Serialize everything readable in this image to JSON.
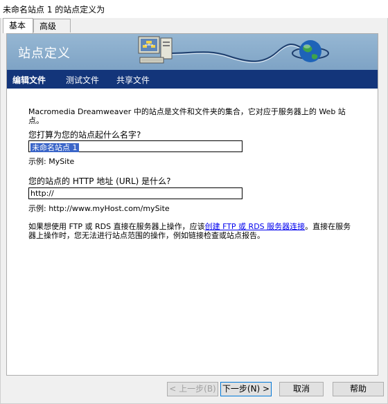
{
  "window": {
    "title": "未命名站点 1 的站点定义为"
  },
  "tabs": [
    {
      "label": "基本",
      "active": true
    },
    {
      "label": "高级",
      "active": false
    }
  ],
  "banner": {
    "title": "站点定义"
  },
  "subnav": [
    {
      "label": "编辑文件",
      "active": true
    },
    {
      "label": "测试文件",
      "active": false
    },
    {
      "label": "共享文件",
      "active": false
    }
  ],
  "form": {
    "description": "Macromedia Dreamweaver 中的站点是文件和文件夹的集合，它对应于服务器上的 Web 站点。",
    "site_name_question": "您打算为您的站点起什么名字?",
    "site_name_value": "未命名站点 1",
    "site_name_example": "示例: MySite",
    "http_question": "您的站点的 HTTP 地址 (URL) 是什么?",
    "http_value": "http://",
    "http_example": "示例: http://www.myHost.com/mySite",
    "note_before": "如果想使用 FTP 或 RDS 直接在服务器上操作，应该",
    "note_link": "创建 FTP 或 RDS 服务器连接",
    "note_after": "。直接在服务器上操作时，您无法进行站点范围的操作，例如链接检查或站点报告。"
  },
  "buttons": {
    "back": "< 上一步(B)",
    "next": "下一步(N) >",
    "cancel": "取消",
    "help": "帮助"
  },
  "colors": {
    "banner": "#8aadd0",
    "subnav": "#13357a",
    "selection": "#3a65c8"
  }
}
